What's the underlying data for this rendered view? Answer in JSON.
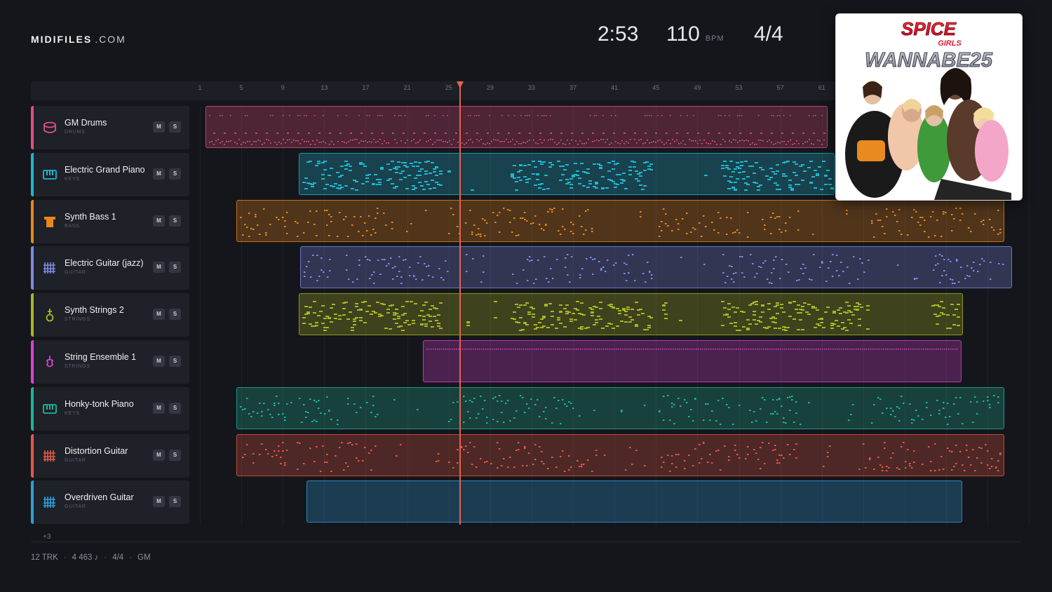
{
  "logo": {
    "brand": "MIDIFILES",
    "suffix": ".COM"
  },
  "transport": {
    "time": "2:53",
    "bpm": "110",
    "bpm_unit": "BPM",
    "time_signature": "4/4"
  },
  "ruler": {
    "ticks": [
      "1",
      "5",
      "9",
      "13",
      "17",
      "21",
      "25",
      "29",
      "33",
      "37",
      "41",
      "45",
      "49",
      "53",
      "57",
      "61"
    ]
  },
  "tracks": [
    {
      "name": "GM Drums",
      "category": "DRUMS",
      "color": "#e0507e",
      "icon": "drum-icon",
      "mute": "M",
      "solo": "S"
    },
    {
      "name": "Electric Grand Piano",
      "category": "KEYS",
      "color": "#1fb6cf",
      "icon": "piano-icon",
      "mute": "M",
      "solo": "S"
    },
    {
      "name": "Synth Bass 1",
      "category": "BASS",
      "color": "#e8871c",
      "icon": "bass-icon",
      "mute": "M",
      "solo": "S"
    },
    {
      "name": "Electric Guitar (jazz)",
      "category": "GUITAR",
      "color": "#7e8be6",
      "icon": "guitar-icon",
      "mute": "M",
      "solo": "S"
    },
    {
      "name": "Synth Strings 2",
      "category": "STRINGS",
      "color": "#a9b624",
      "icon": "strings-icon",
      "mute": "M",
      "solo": "S"
    },
    {
      "name": "String Ensemble 1",
      "category": "STRINGS",
      "color": "#d943d4",
      "icon": "violin-icon",
      "mute": "M",
      "solo": "S"
    },
    {
      "name": "Honky-tonk Piano",
      "category": "KEYS",
      "color": "#1fb59b",
      "icon": "piano-icon",
      "mute": "M",
      "solo": "S"
    },
    {
      "name": "Distortion Guitar",
      "category": "GUITAR",
      "color": "#e35a45",
      "icon": "guitar-icon",
      "mute": "M",
      "solo": "S"
    },
    {
      "name": "Overdriven Guitar",
      "category": "GUITAR",
      "color": "#2da0e0",
      "icon": "guitar-icon",
      "mute": "M",
      "solo": "S"
    }
  ],
  "more_tracks": "+3",
  "footer": {
    "tracks": "12 TRK",
    "notes": "4 463 ♪",
    "time_signature": "4/4",
    "standard": "GM"
  },
  "cover": {
    "title_line1": "SPICE",
    "title_line2": "GIRLS",
    "title_line3": "WANNABE25"
  }
}
